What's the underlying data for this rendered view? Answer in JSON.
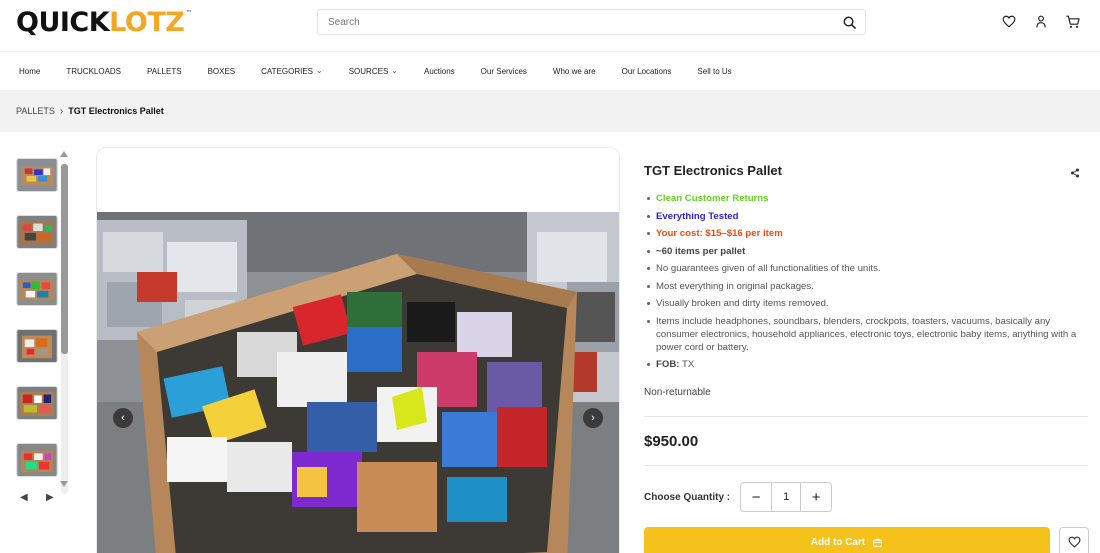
{
  "brand": {
    "part1": "QUICK",
    "part2": "LOTZ",
    "tm": "™",
    "accent": "#f5a623"
  },
  "search": {
    "placeholder": "Search",
    "icon": "search-icon"
  },
  "header_icons": [
    "heart-icon",
    "user-icon",
    "cart-icon"
  ],
  "nav": [
    {
      "label": "Home",
      "dropdown": false
    },
    {
      "label": "TRUCKLOADS",
      "dropdown": false
    },
    {
      "label": "PALLETS",
      "dropdown": false
    },
    {
      "label": "BOXES",
      "dropdown": false
    },
    {
      "label": "CATEGORIES",
      "dropdown": true
    },
    {
      "label": "SOURCES",
      "dropdown": true
    },
    {
      "label": "Auctions",
      "dropdown": false
    },
    {
      "label": "Our Services",
      "dropdown": false
    },
    {
      "label": "Who we are",
      "dropdown": false
    },
    {
      "label": "Our Locations",
      "dropdown": false
    },
    {
      "label": "Sell to Us",
      "dropdown": false
    }
  ],
  "breadcrumb": {
    "parent": "PALLETS",
    "separator": "›",
    "current": "TGT Electronics Pallet"
  },
  "gallery": {
    "thumbnail_count": 6,
    "prev_icon": "chevron-left-icon",
    "next_icon": "chevron-right-icon",
    "thumb_prev": "◀",
    "thumb_next": "▶"
  },
  "product": {
    "title": "TGT Electronics Pallet",
    "bullets": [
      {
        "text": "Clean Customer Returns",
        "style": "green"
      },
      {
        "text": "Everything Tested",
        "style": "blue"
      },
      {
        "text": "Your cost: $15–$16 per item",
        "style": "red"
      },
      {
        "text": "~60 items per pallet",
        "style": "bold"
      },
      {
        "text": "No guarantees given of all functionalities of the units.",
        "style": "normal"
      },
      {
        "text": "Most everything in original packages.",
        "style": "normal"
      },
      {
        "text": "Visually broken and dirty items removed.",
        "style": "normal"
      },
      {
        "text": "Items include headphones, soundbars, blenders, crockpots, toasters, vacuums, basically any consumer electronics, household appliances, electronic toys, electronic baby items, anything with a power cord or battery.",
        "style": "normal"
      }
    ],
    "fob_label": "FOB:",
    "fob_value": "TX",
    "returns": "Non-returnable",
    "price": "$950.00",
    "quantity_label": "Choose Quantity :",
    "quantity": "1",
    "minus": "−",
    "plus": "+",
    "add_to_cart": "Add to Cart",
    "colors": {
      "green": "#66d31f",
      "blue": "#2a1fd4",
      "red": "#f24a0d",
      "button": "#f5c21b"
    }
  }
}
